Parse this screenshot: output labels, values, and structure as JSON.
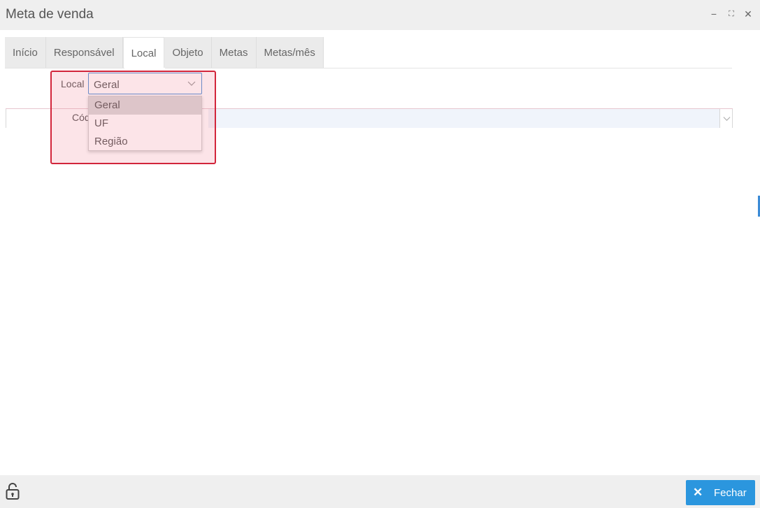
{
  "window": {
    "title": "Meta de venda",
    "controls": {
      "minimize": "−",
      "maximize": "⛶",
      "close": "✕"
    }
  },
  "tabs": [
    {
      "label": "Início"
    },
    {
      "label": "Responsável"
    },
    {
      "label": "Local"
    },
    {
      "label": "Objeto"
    },
    {
      "label": "Metas"
    },
    {
      "label": "Metas/mês"
    }
  ],
  "active_tab": "Local",
  "form": {
    "local_label": "Local",
    "local_value": "Geral",
    "code_label_partial": "Cód",
    "dropdown_options": [
      "Geral",
      "UF",
      "Região"
    ],
    "dropdown_selected": "Geral"
  },
  "footer": {
    "close_label": "Fechar",
    "close_icon": "close-icon",
    "lock_icon": "unlock-icon"
  },
  "colors": {
    "accent": "#2b96de",
    "highlight_border": "#d2253b",
    "select_border": "#4a8fd6"
  }
}
